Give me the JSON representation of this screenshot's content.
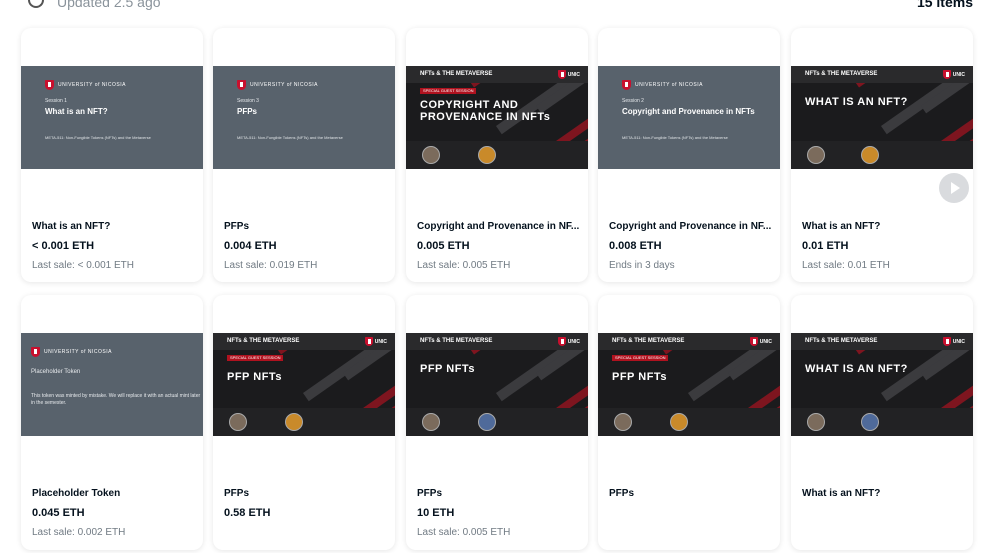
{
  "header": {
    "updated_text": "Updated 2.5 ago",
    "items_count": "15 items"
  },
  "cards": [
    {
      "name": "What is an NFT?",
      "price": "< 0.001 ETH",
      "sub": "Last sale: < 0.001 ETH",
      "media": {
        "kind": "grey",
        "uni": "UNIVERSITY of NICOSIA",
        "session": "Session 1",
        "title": "What is an NFT?",
        "course": "META-511: Non-Fungible Tokens (NFTs) and the Metaverse"
      }
    },
    {
      "name": "PFPs",
      "price": "0.004 ETH",
      "sub": "Last sale: 0.019 ETH",
      "media": {
        "kind": "grey",
        "uni": "UNIVERSITY of NICOSIA",
        "session": "Session 3",
        "title": "PFPs",
        "course": "META-511: Non-Fungible Tokens (NFTs) and the Metaverse"
      }
    },
    {
      "name": "Copyright and Provenance in NF...",
      "price": "0.005 ETH",
      "sub": "Last sale: 0.005 ETH",
      "media": {
        "kind": "dark",
        "brand": "NFTs & THE METAVERSE",
        "unic": "UNIC",
        "guest": "SPECIAL GUEST SESSION",
        "title_line1": "COPYRIGHT AND",
        "title_line2": "PROVENANCE IN NFTs"
      }
    },
    {
      "name": "Copyright and Provenance in NF...",
      "price": "0.008 ETH",
      "sub": "Ends in 3 days",
      "media": {
        "kind": "grey",
        "uni": "UNIVERSITY of NICOSIA",
        "session": "Session 2",
        "title": "Copyright and Provenance in NFTs",
        "course": "META-511: Non-Fungible Tokens (NFTs) and the Metaverse"
      }
    },
    {
      "name": "What is an NFT?",
      "price": "0.01 ETH",
      "sub": "Last sale: 0.01 ETH",
      "media": {
        "kind": "dark",
        "brand": "NFTs & THE METAVERSE",
        "unic": "UNIC",
        "guest": "",
        "title_line1": "WHAT IS AN NFT?",
        "title_line2": ""
      }
    },
    {
      "name": "Placeholder Token",
      "price": "0.045 ETH",
      "sub": "Last sale: 0.002 ETH",
      "media": {
        "kind": "grey-desc",
        "uni": "UNIVERSITY of NICOSIA",
        "session": "Placeholder Token",
        "desc": "This token was minted by mistake. We will replace it with an actual mint later in the semester."
      }
    },
    {
      "name": "PFPs",
      "price": "0.58 ETH",
      "sub": "",
      "media": {
        "kind": "dark",
        "brand": "NFTs & THE METAVERSE",
        "unic": "UNIC",
        "guest": "SPECIAL GUEST SESSION",
        "title_line1": "PFP NFTs",
        "title_line2": ""
      }
    },
    {
      "name": "PFPs",
      "price": "10 ETH",
      "sub": "Last sale: 0.005 ETH",
      "media": {
        "kind": "dark",
        "brand": "NFTs & THE METAVERSE",
        "unic": "UNIC",
        "guest": "",
        "title_line1": "PFP NFTs",
        "title_line2": ""
      }
    },
    {
      "name": "PFPs",
      "price": "",
      "sub": "",
      "media": {
        "kind": "dark",
        "brand": "NFTs & THE METAVERSE",
        "unic": "UNIC",
        "guest": "SPECIAL GUEST SESSION",
        "title_line1": "PFP NFTs",
        "title_line2": ""
      }
    },
    {
      "name": "What is an NFT?",
      "price": "",
      "sub": "",
      "media": {
        "kind": "dark",
        "brand": "NFTs & THE METAVERSE",
        "unic": "UNIC",
        "guest": "",
        "title_line1": "WHAT IS AN NFT?",
        "title_line2": ""
      }
    }
  ],
  "colors": {
    "accent_red": "#c8102e",
    "slide_grey": "#58626c",
    "muted_text": "#707a83"
  }
}
